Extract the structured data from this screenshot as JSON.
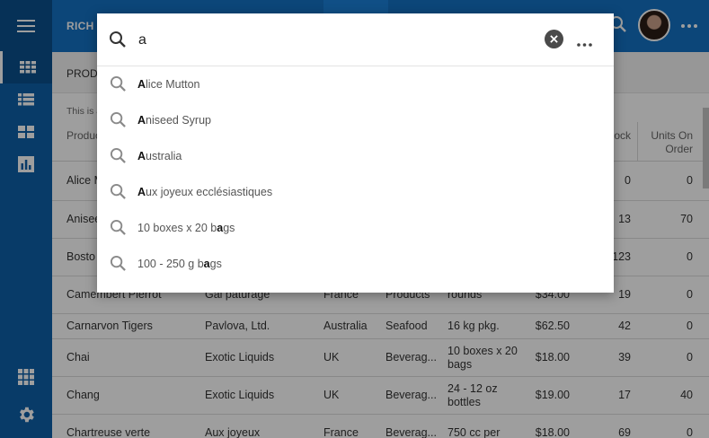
{
  "header": {
    "title": "RICH T"
  },
  "breadcrumb": "PRODU",
  "description": "This is a",
  "grid": {
    "columns": [
      {
        "label": "Produc"
      },
      {
        "label": "s In ock"
      },
      {
        "label": "Units On Order"
      }
    ],
    "rows": [
      {
        "product": "Alice M",
        "supplier": "",
        "country": "",
        "category": "",
        "qty": "",
        "price": "",
        "stock": "0",
        "order": "0"
      },
      {
        "product": "Anisee",
        "supplier": "",
        "country": "",
        "category": "",
        "qty": "",
        "price": "",
        "stock": "13",
        "order": "70"
      },
      {
        "product": "Bosto",
        "supplier": "",
        "country": "",
        "category": "",
        "qty": "",
        "price": "",
        "stock": "123",
        "order": "0"
      },
      {
        "product": "Camembert Pierrot",
        "supplier": "Gai pâturage",
        "country": "France",
        "category": "Products",
        "qty": "rounds",
        "price": "$34.00",
        "stock": "19",
        "order": "0"
      },
      {
        "product": "Carnarvon Tigers",
        "supplier": "Pavlova, Ltd.",
        "country": "Australia",
        "category": "Seafood",
        "qty": "16 kg pkg.",
        "price": "$62.50",
        "stock": "42",
        "order": "0"
      },
      {
        "product": "Chai",
        "supplier": "Exotic Liquids",
        "country": "UK",
        "category": "Beverag...",
        "qty": "10 boxes x 20 bags",
        "price": "$18.00",
        "stock": "39",
        "order": "0"
      },
      {
        "product": "Chang",
        "supplier": "Exotic Liquids",
        "country": "UK",
        "category": "Beverag...",
        "qty": "24 - 12 oz bottles",
        "price": "$19.00",
        "stock": "17",
        "order": "40"
      },
      {
        "product": "Chartreuse verte",
        "supplier": "Aux joyeux",
        "country": "France",
        "category": "Beverag...",
        "qty": "750 cc per",
        "price": "$18.00",
        "stock": "69",
        "order": "0"
      }
    ]
  },
  "search": {
    "value": "a",
    "suggestions": [
      {
        "match": "A",
        "before": "",
        "after": "lice Mutton"
      },
      {
        "match": "A",
        "before": "",
        "after": "niseed Syrup"
      },
      {
        "match": "A",
        "before": "",
        "after": "ustralia"
      },
      {
        "match": "A",
        "before": "",
        "after": "ux joyeux ecclésiastiques"
      },
      {
        "match": "a",
        "before": "10 boxes x 20 b",
        "after": "gs"
      },
      {
        "match": "a",
        "before": "100 - 250 g b",
        "after": "gs"
      }
    ]
  },
  "icons": {
    "menu": "hamburger-icon",
    "nav": [
      "grid-icon",
      "list-icon",
      "tiles-icon",
      "chart-icon"
    ],
    "apps": "apps-icon",
    "settings": "gear-icon",
    "search": "search-icon",
    "clear": "close-circle-icon",
    "more": "more-horizontal-icon"
  },
  "colors": {
    "rail": "#0d5fa8",
    "header": "#1472c4",
    "accent": "#ffffff"
  }
}
